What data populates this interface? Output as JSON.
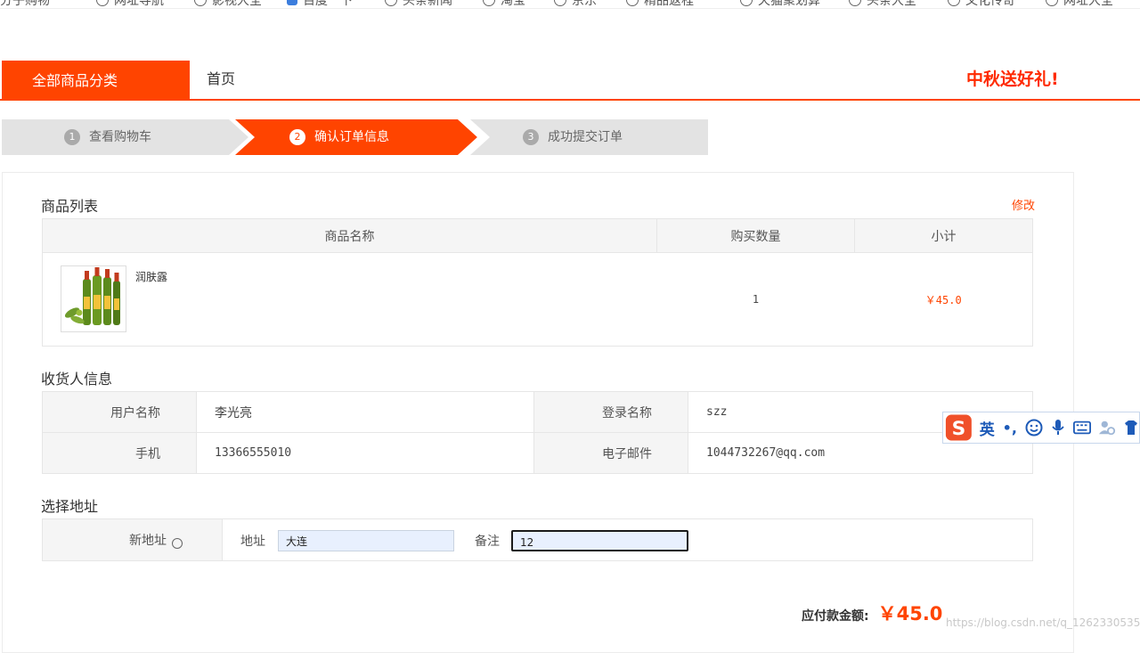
{
  "bookmarks": [
    "分子购物",
    "网址导航",
    "影视大全",
    "百度一下",
    "头条新闻",
    "淘宝",
    "京东",
    "精品返程",
    "天猫聚划算",
    "头条大全",
    "文化传奇",
    "网址大全"
  ],
  "nav": {
    "category_button": "全部商品分类",
    "home": "首页",
    "promo": "中秋送好礼!"
  },
  "steps": [
    {
      "num": "1",
      "label": "查看购物车",
      "active": false
    },
    {
      "num": "2",
      "label": "确认订单信息",
      "active": true
    },
    {
      "num": "3",
      "label": "成功提交订单",
      "active": false
    }
  ],
  "goods": {
    "title": "商品列表",
    "edit": "修改",
    "headers": [
      "商品名称",
      "购买数量",
      "小计"
    ],
    "rows": [
      {
        "name": "润肤露",
        "qty": "1",
        "subtotal": "￥45.0"
      }
    ]
  },
  "receiver": {
    "title": "收货人信息",
    "rows": [
      {
        "label1": "用户名称",
        "value1": "李光亮",
        "label2": "登录名称",
        "value2": "szz"
      },
      {
        "label1": "手机",
        "value1": "13366555010",
        "label2": "电子邮件",
        "value2": "1044732267@qq.com"
      }
    ]
  },
  "address": {
    "title": "选择地址",
    "new_address": "新地址",
    "address_label": "地址",
    "address_value": "大连",
    "note_label": "备注",
    "note_value": "12"
  },
  "total": {
    "label": "应付款金额:",
    "value": "￥45.0"
  },
  "watermark": "https://blog.csdn.net/q_1262330535",
  "ime": {
    "lang": "英",
    "punct": "•,",
    "logo_letter": "S"
  },
  "colors": {
    "accent": "#ff4400",
    "promo": "#ff2a00"
  }
}
